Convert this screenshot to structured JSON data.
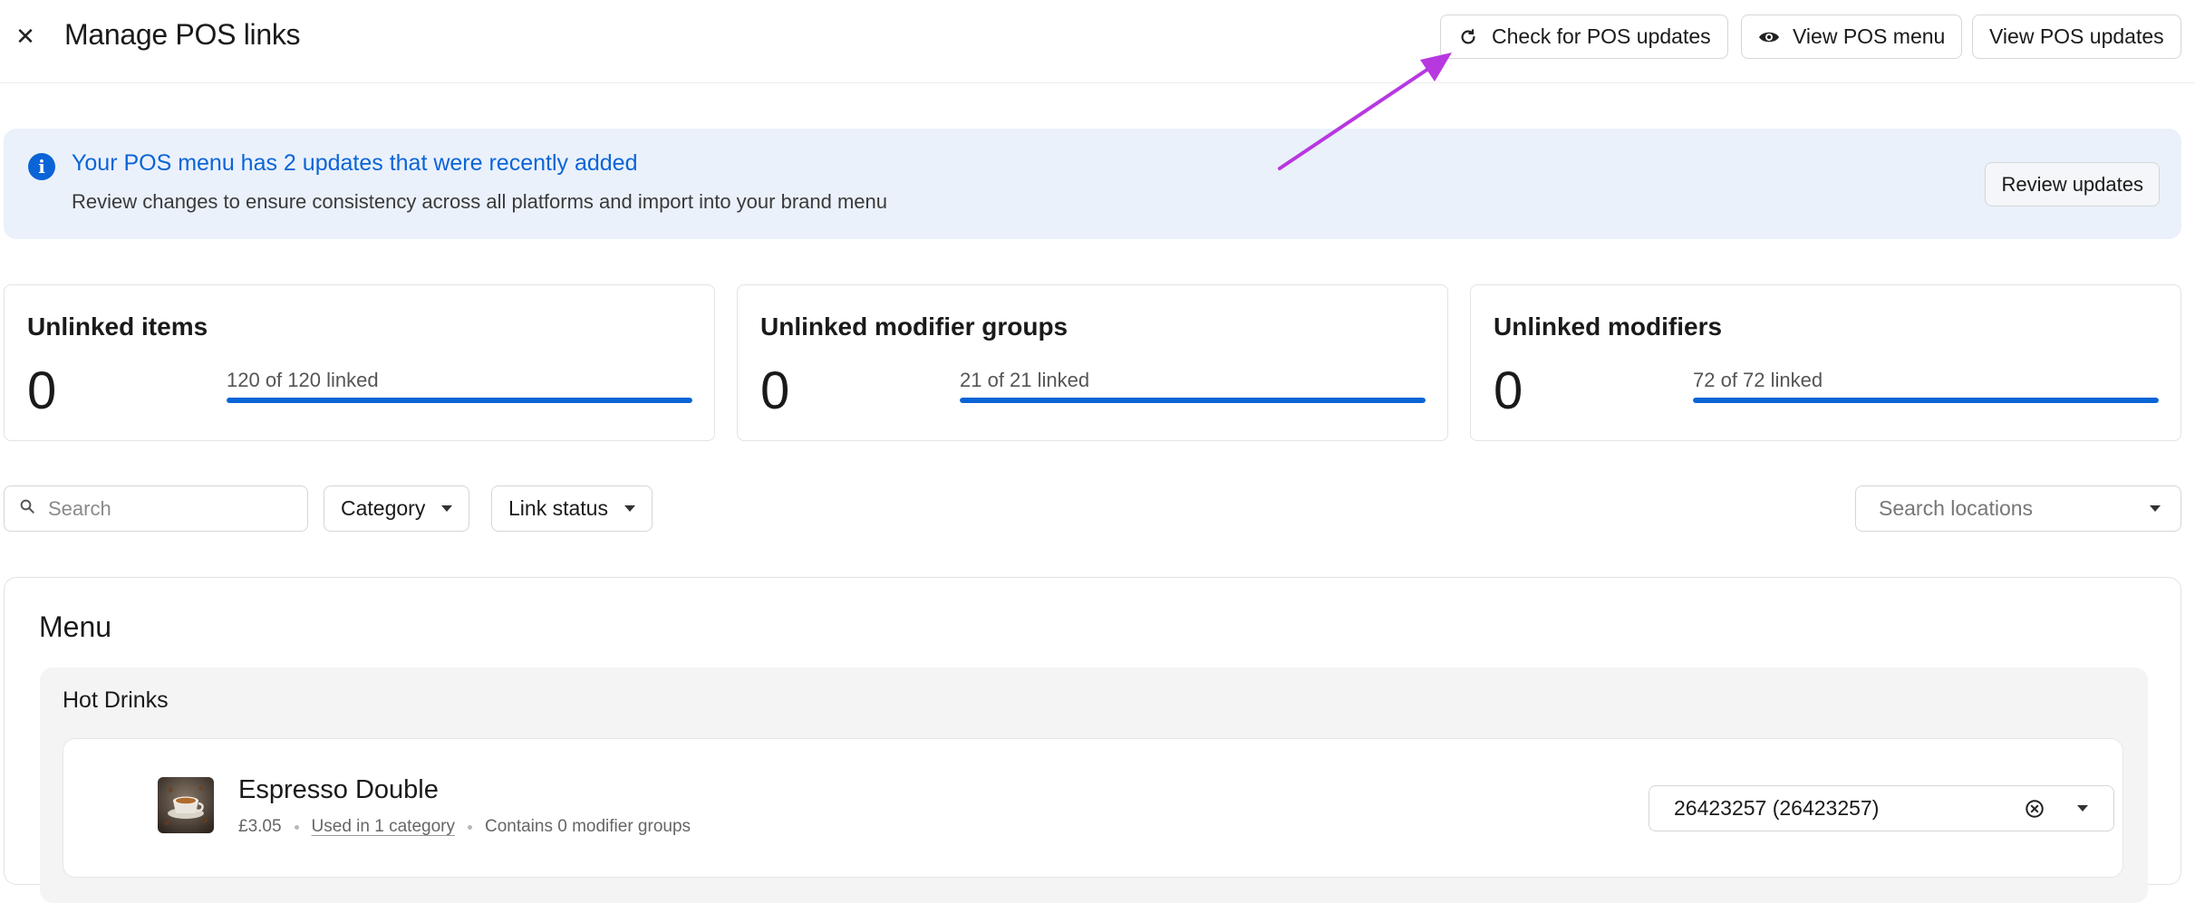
{
  "header": {
    "close_icon": "close-icon",
    "title": "Manage POS links",
    "buttons": {
      "check_updates": "Check for POS updates",
      "view_menu": "View POS menu",
      "view_updates": "View POS updates"
    }
  },
  "banner": {
    "icon": "info-icon",
    "title": "Your POS menu has 2 updates that were recently added",
    "text": "Review changes to ensure consistency across all platforms and import into your brand menu",
    "button": "Review updates",
    "accent": "#0b64d6",
    "background": "#eaf1fb"
  },
  "stats": [
    {
      "title": "Unlinked items",
      "count": "0",
      "linked_text": "120 of 120 linked",
      "progress": 1.0
    },
    {
      "title": "Unlinked modifier groups",
      "count": "0",
      "linked_text": "21 of 21 linked",
      "progress": 1.0
    },
    {
      "title": "Unlinked modifiers",
      "count": "0",
      "linked_text": "72 of 72 linked",
      "progress": 1.0
    }
  ],
  "filters": {
    "search_placeholder": "Search",
    "category": "Category",
    "link_status": "Link status",
    "locations_placeholder": "Search locations"
  },
  "menu": {
    "title": "Menu",
    "categories": [
      {
        "name": "Hot Drinks",
        "items": [
          {
            "name": "Espresso Double",
            "price": "£3.05",
            "used_in": "Used in 1 category",
            "modifier_groups": "Contains 0 modifier groups",
            "pos_link": "26423257 (26423257)"
          }
        ]
      }
    ]
  },
  "annotation": {
    "color": "#b838e0"
  }
}
